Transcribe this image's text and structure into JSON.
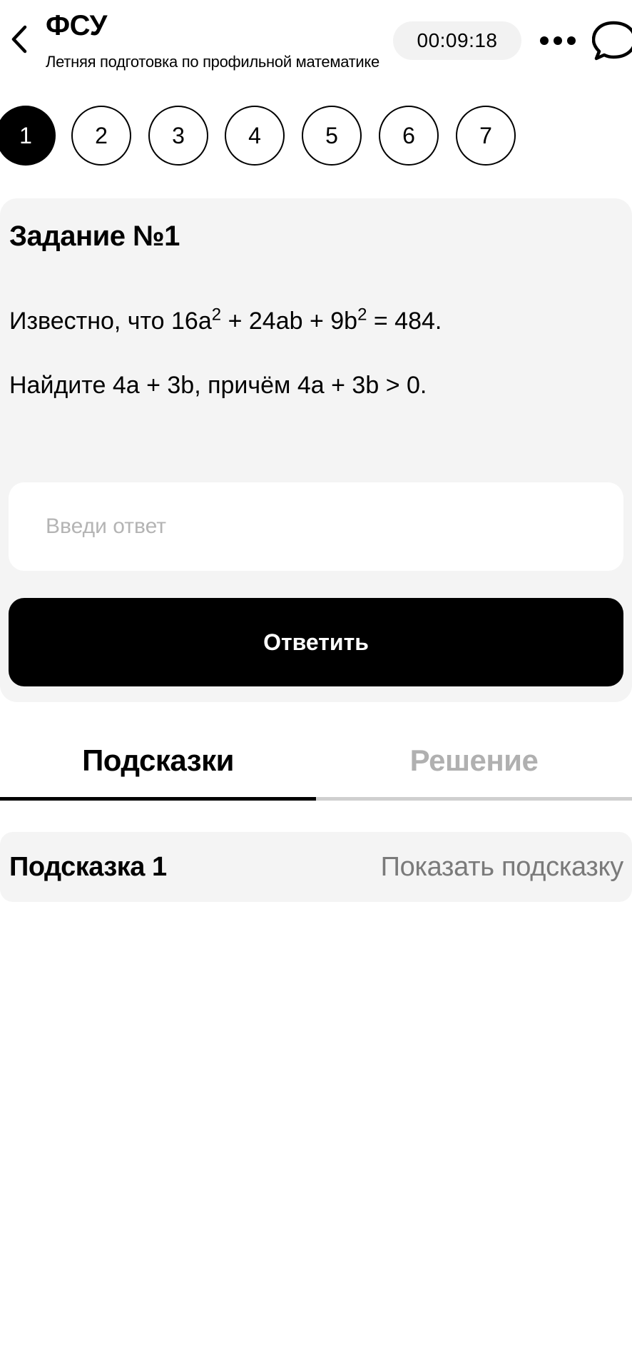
{
  "header": {
    "title": "ФСУ",
    "subtitle": "Летняя подготовка по профильной математике",
    "timer": "00:09:18"
  },
  "icons": {
    "back": "chevron-left-icon",
    "more": "more-horizontal-icon",
    "chat": "chat-bubble-icon"
  },
  "task_nav": {
    "items": [
      "1",
      "2",
      "3",
      "4",
      "5",
      "6",
      "7"
    ],
    "active": "1"
  },
  "task": {
    "heading": "Задание №1",
    "line1": {
      "pre": "Известно, что 16a",
      "sup1": "2",
      "mid": " + 24ab + 9b",
      "sup2": "2",
      "post": " = 484."
    },
    "line2": "Найдите 4a + 3b, причём 4a + 3b > 0.",
    "answer_placeholder": "Введи ответ",
    "answer_value": "",
    "submit_label": "Ответить"
  },
  "tabs": {
    "hints_label": "Подсказки",
    "solution_label": "Решение",
    "active": "hints"
  },
  "hints": [
    {
      "label": "Подсказка 1",
      "action": "Показать подсказку"
    }
  ],
  "colors": {
    "background": "#ffffff",
    "card": "#f4f4f4",
    "accent": "#000000",
    "muted_text": "#7a7a7a",
    "inactive_tab": "#b0b0b0",
    "placeholder": "#b4b4b4"
  }
}
